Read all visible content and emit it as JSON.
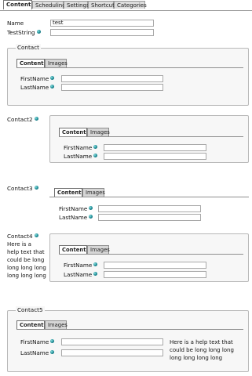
{
  "top_tabs": [
    {
      "label": "Content"
    },
    {
      "label": "Scheduling"
    },
    {
      "label": "Settings"
    },
    {
      "label": "Shortcut"
    },
    {
      "label": "Categories"
    }
  ],
  "main": {
    "name_label": "Name",
    "name_value": "test",
    "teststring_label": "TestString",
    "teststring_value": ""
  },
  "inner_tabs": {
    "content": "Content",
    "images": "Images"
  },
  "contact": {
    "title": "Contact",
    "firstname_label": "FirstName",
    "lastname_label": "LastName"
  },
  "contact2": {
    "title": "Contact2",
    "firstname_label": "FirstName",
    "lastname_label": "LastName"
  },
  "contact3": {
    "title": "Contact3",
    "firstname_label": "FirstName",
    "lastname_label": "LastName"
  },
  "contact4": {
    "title": "Contact4",
    "help_lines": [
      "Here is a",
      "help text that",
      "could be long",
      "long long long",
      "long long long"
    ],
    "firstname_label": "FirstName",
    "lastname_label": "LastName"
  },
  "contact5": {
    "title": "Contact5",
    "firstname_label": "FirstName",
    "lastname_label": "LastName",
    "help_lines": [
      "Here is a help text that",
      "could be long long long",
      "long long long long"
    ]
  }
}
